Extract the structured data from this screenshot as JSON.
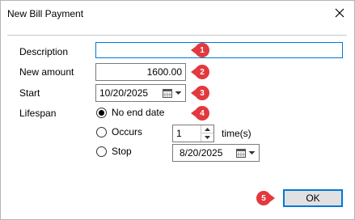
{
  "dialog": {
    "title": "New Bill Payment",
    "close_symbol": "✕"
  },
  "fields": {
    "description_label": "Description",
    "description_value": "",
    "amount_label": "New amount",
    "amount_value": "1600.00",
    "start_label": "Start",
    "start_value": "10/20/2025",
    "lifespan_label": "Lifespan"
  },
  "lifespan": {
    "options": [
      {
        "label": "No end date",
        "checked": true
      },
      {
        "label": "Occurs",
        "checked": false
      },
      {
        "label": "Stop",
        "checked": false
      }
    ],
    "occurs_count": "1",
    "occurs_unit": "time(s)",
    "stop_date": "8/20/2025"
  },
  "buttons": {
    "ok_label": "OK"
  },
  "callouts": [
    "1",
    "2",
    "3",
    "4",
    "5"
  ],
  "colors": {
    "accent": "#0078d7",
    "callout": "#e2393f"
  }
}
